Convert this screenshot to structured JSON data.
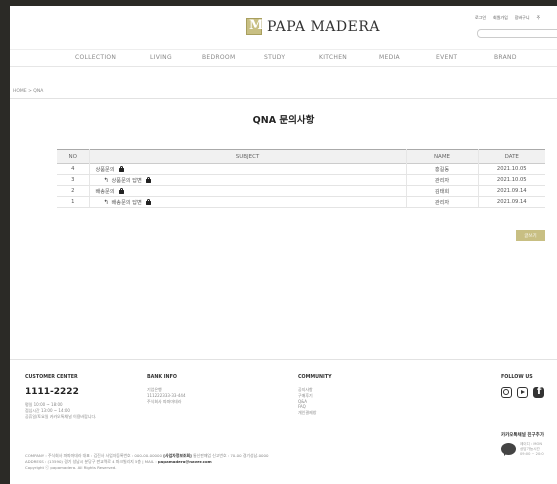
{
  "header": {
    "brand": "PAPA MADERA",
    "top_links": [
      "로그인",
      "회원가입",
      "장바구니",
      "주"
    ],
    "search_placeholder": ""
  },
  "nav": [
    "COLLECTION",
    "LIVING",
    "BEDROOM",
    "STUDY",
    "KITCHEN",
    "MEDIA",
    "EVENT",
    "BRAND"
  ],
  "breadcrumb": "HOME > QNA",
  "page_title": "QNA 문의사항",
  "table": {
    "headers": {
      "no": "NO",
      "subject": "SUBJECT",
      "name": "NAME",
      "date": "DATE"
    },
    "rows": [
      {
        "no": "4",
        "subject": "상품문의",
        "reply": false,
        "name": "홍길동",
        "date": "2021.10.05"
      },
      {
        "no": "3",
        "subject": "상품문의 답변",
        "reply": true,
        "name": "관리자",
        "date": "2021.10.05"
      },
      {
        "no": "2",
        "subject": "배송문의",
        "reply": false,
        "name": "김태희",
        "date": "2021.09.14"
      },
      {
        "no": "1",
        "subject": "배송문의 답변",
        "reply": true,
        "name": "관리자",
        "date": "2021.09.14"
      }
    ]
  },
  "write_button": "글쓰기",
  "footer": {
    "customer_center": {
      "title": "CUSTOMER CENTER",
      "phone": "1111-2222",
      "lines": [
        "평일 10:00 ~ 18:00",
        "점심시간 13:00 ~ 14:00",
        "공휴일/토요일 카카오톡채널 이용바랍니다."
      ]
    },
    "bank_info": {
      "title": "BANK INFO",
      "lines": [
        "기업은행",
        "111222333-33-444",
        "주식회사 파파마데라"
      ]
    },
    "community": {
      "title": "COMMUNITY",
      "lines": [
        "공지사항",
        "구매후기",
        "Q&A",
        "FAQ",
        "개인결제창"
      ]
    },
    "follow_us": {
      "title": "FOLLOW US",
      "icons": [
        "instagram-icon",
        "youtube-icon",
        "facebook-icon"
      ]
    },
    "kakao": {
      "title": "카카오톡채널 친구추가",
      "lines": [
        "제이디 : MON",
        "상담가능시간",
        "09:00 ~ 20:0"
      ]
    },
    "company_line_1a": "COMPANY : 주식회사 파파마데라  대표 : 김진사   사업자등록번호 : 000-00-00000 ",
    "company_line_1b": "[사업자정보조회]",
    "company_line_1c": "   통신판매업 신고번호 : 70-00 경기성남-0000",
    "company_line_2a": "ADDRESS : (13590) 경기 성남시 분당구 판교역로 4 파크빌리지 5층   |   MAIL : ",
    "company_line_2b": "papamadera@naver.com",
    "company_line_3": "Copyright ⓒ papamadera. All Rights Reserved."
  },
  "colors": {
    "accent": "#c8bf83",
    "background_outer": "#2b2a26"
  }
}
